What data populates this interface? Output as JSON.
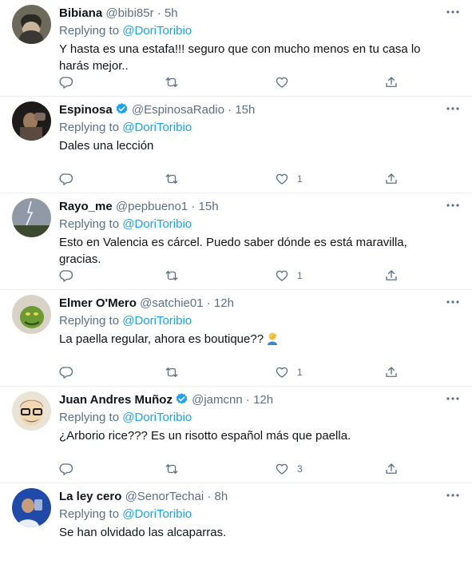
{
  "replying_label": "Replying to",
  "mention": "@DoriToribio",
  "dot": "·",
  "tweets": [
    {
      "name": "Bibiana",
      "handle": "@bibi85r",
      "time": "5h",
      "verified": false,
      "text": "Y hasta es una estafa!!! seguro que con mucho menos en tu casa lo harás mejor..",
      "likes": ""
    },
    {
      "name": "Espinosa",
      "handle": "@EspinosaRadio",
      "time": "15h",
      "verified": true,
      "text": "Dales una lección",
      "likes": "1"
    },
    {
      "name": "Rayo_me",
      "handle": "@pepbueno1",
      "time": "15h",
      "verified": false,
      "text": "Esto en Valencia es cárcel. Puedo saber dónde es está maravilla, gracias.",
      "likes": "1"
    },
    {
      "name": "Elmer O'Mero",
      "handle": "@satchie01",
      "time": "12h",
      "verified": false,
      "text": "La paella regular, ahora es boutique??",
      "emoji": "man-facepalming-emoji",
      "likes": "1"
    },
    {
      "name": "Juan Andres Muñoz",
      "handle": "@jamcnn",
      "time": "12h",
      "verified": true,
      "text": "¿Arborio rice??? Es un risotto español más que paella.",
      "likes": "3"
    },
    {
      "name": "La ley cero",
      "handle": "@SenorTechai",
      "time": "8h",
      "verified": false,
      "text": "Se han olvidado las alcaparras.",
      "likes": ""
    }
  ],
  "icons": {
    "reply": "reply-icon",
    "retweet": "retweet-icon",
    "like": "heart-icon",
    "share": "share-icon",
    "more": "more-icon",
    "verified": "verified-badge-icon"
  },
  "colors": {
    "accent": "#1da1f2",
    "secondary_text": "#5b7083",
    "divider": "#ebeef0"
  }
}
